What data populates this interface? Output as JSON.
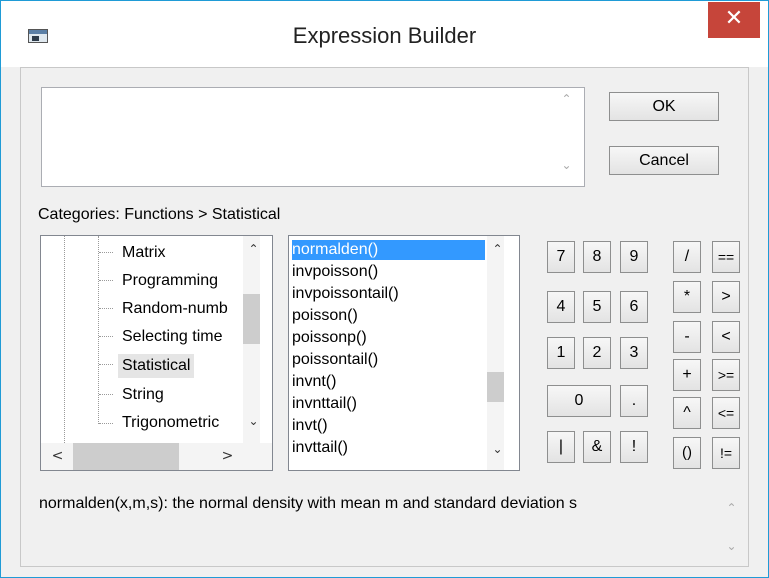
{
  "window": {
    "title": "Expression Builder",
    "close_glyph": "✕"
  },
  "buttons": {
    "ok": "OK",
    "cancel": "Cancel"
  },
  "categories_label": "Categories: Functions > Statistical",
  "tree": {
    "items": [
      "Matrix",
      "Programming",
      "Random-numb",
      "Selecting time",
      "Statistical",
      "String",
      "Trigonometric"
    ],
    "selected": "Statistical"
  },
  "functions": {
    "items": [
      "normalden()",
      "invpoisson()",
      "invpoissontail()",
      "poisson()",
      "poissonp()",
      "poissontail()",
      "invnt()",
      "invnttail()",
      "invt()",
      "invttail()"
    ],
    "selected": "normalden()"
  },
  "keypad": {
    "k7": "7",
    "k8": "8",
    "k9": "9",
    "k4": "4",
    "k5": "5",
    "k6": "6",
    "k1": "1",
    "k2": "2",
    "k3": "3",
    "k0": "0",
    "dot": ".",
    "pipe": "|",
    "amp": "&",
    "bang": "!",
    "div": "/",
    "eq": "==",
    "mul": "*",
    "gt": ">",
    "minus": "-",
    "lt": "<",
    "plus": "+",
    "ge": ">=",
    "pow": "^",
    "le": "<=",
    "parens": "()",
    "ne": "!="
  },
  "description": "normalden(x,m,s):  the normal density with mean m and standard deviation s",
  "scroll_glyphs": {
    "up": "⌃",
    "down": "⌄",
    "left": "<",
    "right": ">"
  },
  "colors": {
    "selection": "#3399ff",
    "close": "#c6453a"
  }
}
